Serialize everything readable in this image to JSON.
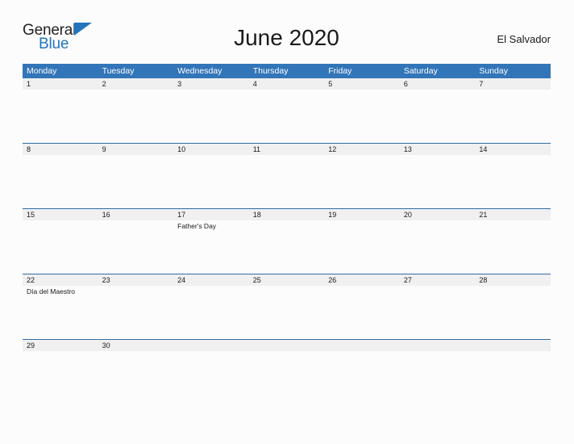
{
  "brand": {
    "name_top": "General",
    "name_bottom": "Blue",
    "flag_icon": "triangle-flag-icon",
    "color_dark": "#231f20",
    "color_blue": "#2175bd"
  },
  "header": {
    "title": "June 2020",
    "region": "El Salvador"
  },
  "colors": {
    "header_blue": "#3275b8",
    "row_divider_blue": "#2e6da4",
    "date_strip_gray": "#f0f0f0",
    "page_background": "#fcfcfd",
    "text": "#1a1a1a"
  },
  "calendar": {
    "month": "June",
    "year": "2020",
    "weekday_headers": [
      "Monday",
      "Tuesday",
      "Wednesday",
      "Thursday",
      "Friday",
      "Saturday",
      "Sunday"
    ],
    "weeks": [
      {
        "days": [
          {
            "date": "1",
            "events": []
          },
          {
            "date": "2",
            "events": []
          },
          {
            "date": "3",
            "events": []
          },
          {
            "date": "4",
            "events": []
          },
          {
            "date": "5",
            "events": []
          },
          {
            "date": "6",
            "events": []
          },
          {
            "date": "7",
            "events": []
          }
        ]
      },
      {
        "days": [
          {
            "date": "8",
            "events": []
          },
          {
            "date": "9",
            "events": []
          },
          {
            "date": "10",
            "events": []
          },
          {
            "date": "11",
            "events": []
          },
          {
            "date": "12",
            "events": []
          },
          {
            "date": "13",
            "events": []
          },
          {
            "date": "14",
            "events": []
          }
        ]
      },
      {
        "days": [
          {
            "date": "15",
            "events": []
          },
          {
            "date": "16",
            "events": []
          },
          {
            "date": "17",
            "events": [
              "Father's Day"
            ]
          },
          {
            "date": "18",
            "events": []
          },
          {
            "date": "19",
            "events": []
          },
          {
            "date": "20",
            "events": []
          },
          {
            "date": "21",
            "events": []
          }
        ]
      },
      {
        "days": [
          {
            "date": "22",
            "events": [
              "Día del Maestro"
            ]
          },
          {
            "date": "23",
            "events": []
          },
          {
            "date": "24",
            "events": []
          },
          {
            "date": "25",
            "events": []
          },
          {
            "date": "26",
            "events": []
          },
          {
            "date": "27",
            "events": []
          },
          {
            "date": "28",
            "events": []
          }
        ]
      },
      {
        "days": [
          {
            "date": "29",
            "events": []
          },
          {
            "date": "30",
            "events": []
          },
          {
            "date": "",
            "events": []
          },
          {
            "date": "",
            "events": []
          },
          {
            "date": "",
            "events": []
          },
          {
            "date": "",
            "events": []
          },
          {
            "date": "",
            "events": []
          }
        ]
      }
    ]
  }
}
